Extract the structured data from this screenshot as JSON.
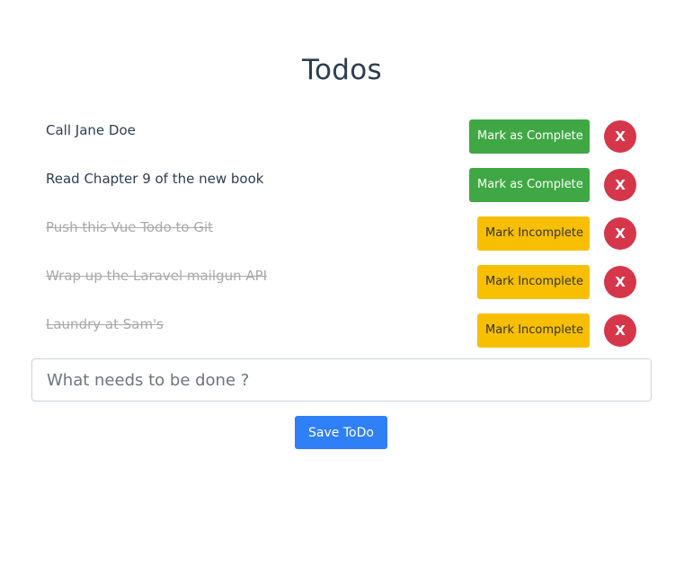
{
  "header": {
    "title": "Todos"
  },
  "todos": [
    {
      "text": "Call Jane Doe",
      "completed": false,
      "action_label": "Mark as Complete",
      "delete_label": "X"
    },
    {
      "text": "Read Chapter 9 of the new book",
      "completed": false,
      "action_label": "Mark as Complete",
      "delete_label": "X"
    },
    {
      "text": "Push this Vue Todo to Git",
      "completed": true,
      "action_label": "Mark Incomplete",
      "delete_label": "X"
    },
    {
      "text": "Wrap up the Laravel mailgun API",
      "completed": true,
      "action_label": "Mark Incomplete",
      "delete_label": "X"
    },
    {
      "text": "Laundry at Sam's",
      "completed": true,
      "action_label": "Mark Incomplete",
      "delete_label": "X"
    }
  ],
  "new_todo": {
    "value": "",
    "placeholder": "What needs to be done ?"
  },
  "save_button": {
    "label": "Save ToDo"
  },
  "colors": {
    "complete_button": "#3fa844",
    "incomplete_button": "#f8bf00",
    "delete_button": "#d5364a",
    "save_button": "#2f7ff7",
    "title": "#2c3e50",
    "completed_text": "#a9a9a9"
  }
}
